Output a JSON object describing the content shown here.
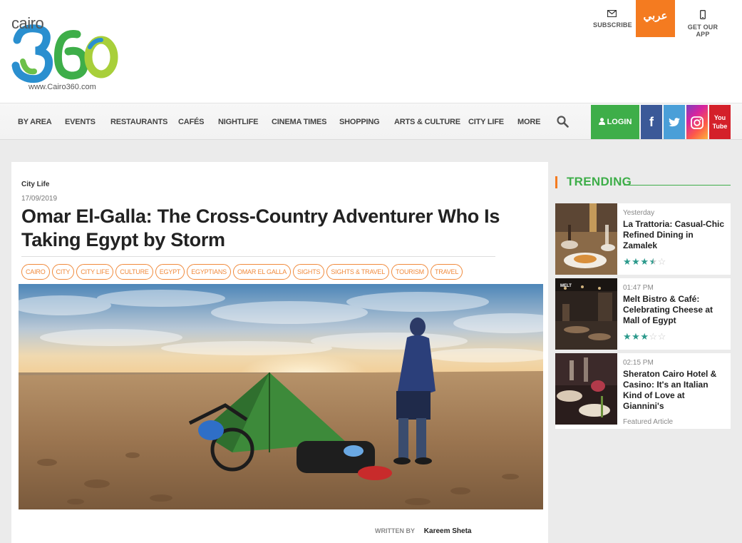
{
  "header": {
    "logo_word": "cairo",
    "logo_number": "360",
    "logo_url": "www.Cairo360.com",
    "subscribe_label": "SUBSCRIBE",
    "arabic_label": "عربي",
    "app_label": "GET OUR APP"
  },
  "nav": {
    "items": [
      "BY AREA",
      "EVENTS",
      "RESTAURANTS",
      "CAFÉS",
      "NIGHTLIFE",
      "CINEMA TIMES",
      "SHOPPING",
      "ARTS & CULTURE",
      "CITY LIFE",
      "MORE"
    ],
    "login_label": "LOGIN",
    "social": {
      "facebook": "f",
      "twitter": "twitter-bird",
      "instagram": "instagram",
      "youtube": "You Tube"
    }
  },
  "article": {
    "category": "City Life",
    "date": "17/09/2019",
    "title": "Omar El-Galla: The Cross-Country Adventurer Who Is Taking Egypt by Storm",
    "tags": [
      "CAIRO",
      "CITY",
      "CITY LIFE",
      "CULTURE",
      "EGYPT",
      "EGYPTIANS",
      "OMAR EL GALLA",
      "SIGHTS",
      "SIGHTS & TRAVEL",
      "TOURISM",
      "TRAVEL"
    ],
    "byline_label": "WRITTEN BY",
    "author": "Kareem Sheta"
  },
  "sidebar": {
    "trending_title": "TRENDING",
    "cards": [
      {
        "meta": "Yesterday",
        "title": "La Trattoria: Casual-Chic Refined Dining in Zamalek",
        "rating": 3.5
      },
      {
        "meta": "01:47 PM",
        "title": "Melt Bistro & Café: Celebrating Cheese at Mall of Egypt",
        "rating": 3
      },
      {
        "meta": "02:15 PM",
        "title": "Sheraton Cairo Hotel & Casino: It's an Italian Kind of Love at Giannini's",
        "footer": "Featured Article"
      }
    ],
    "thumb2_label": "MELT"
  },
  "colors": {
    "brand_orange": "#f47b20",
    "brand_green": "#3eae49",
    "tag_orange": "#f08a3c",
    "star_teal": "#2c9a8c"
  }
}
